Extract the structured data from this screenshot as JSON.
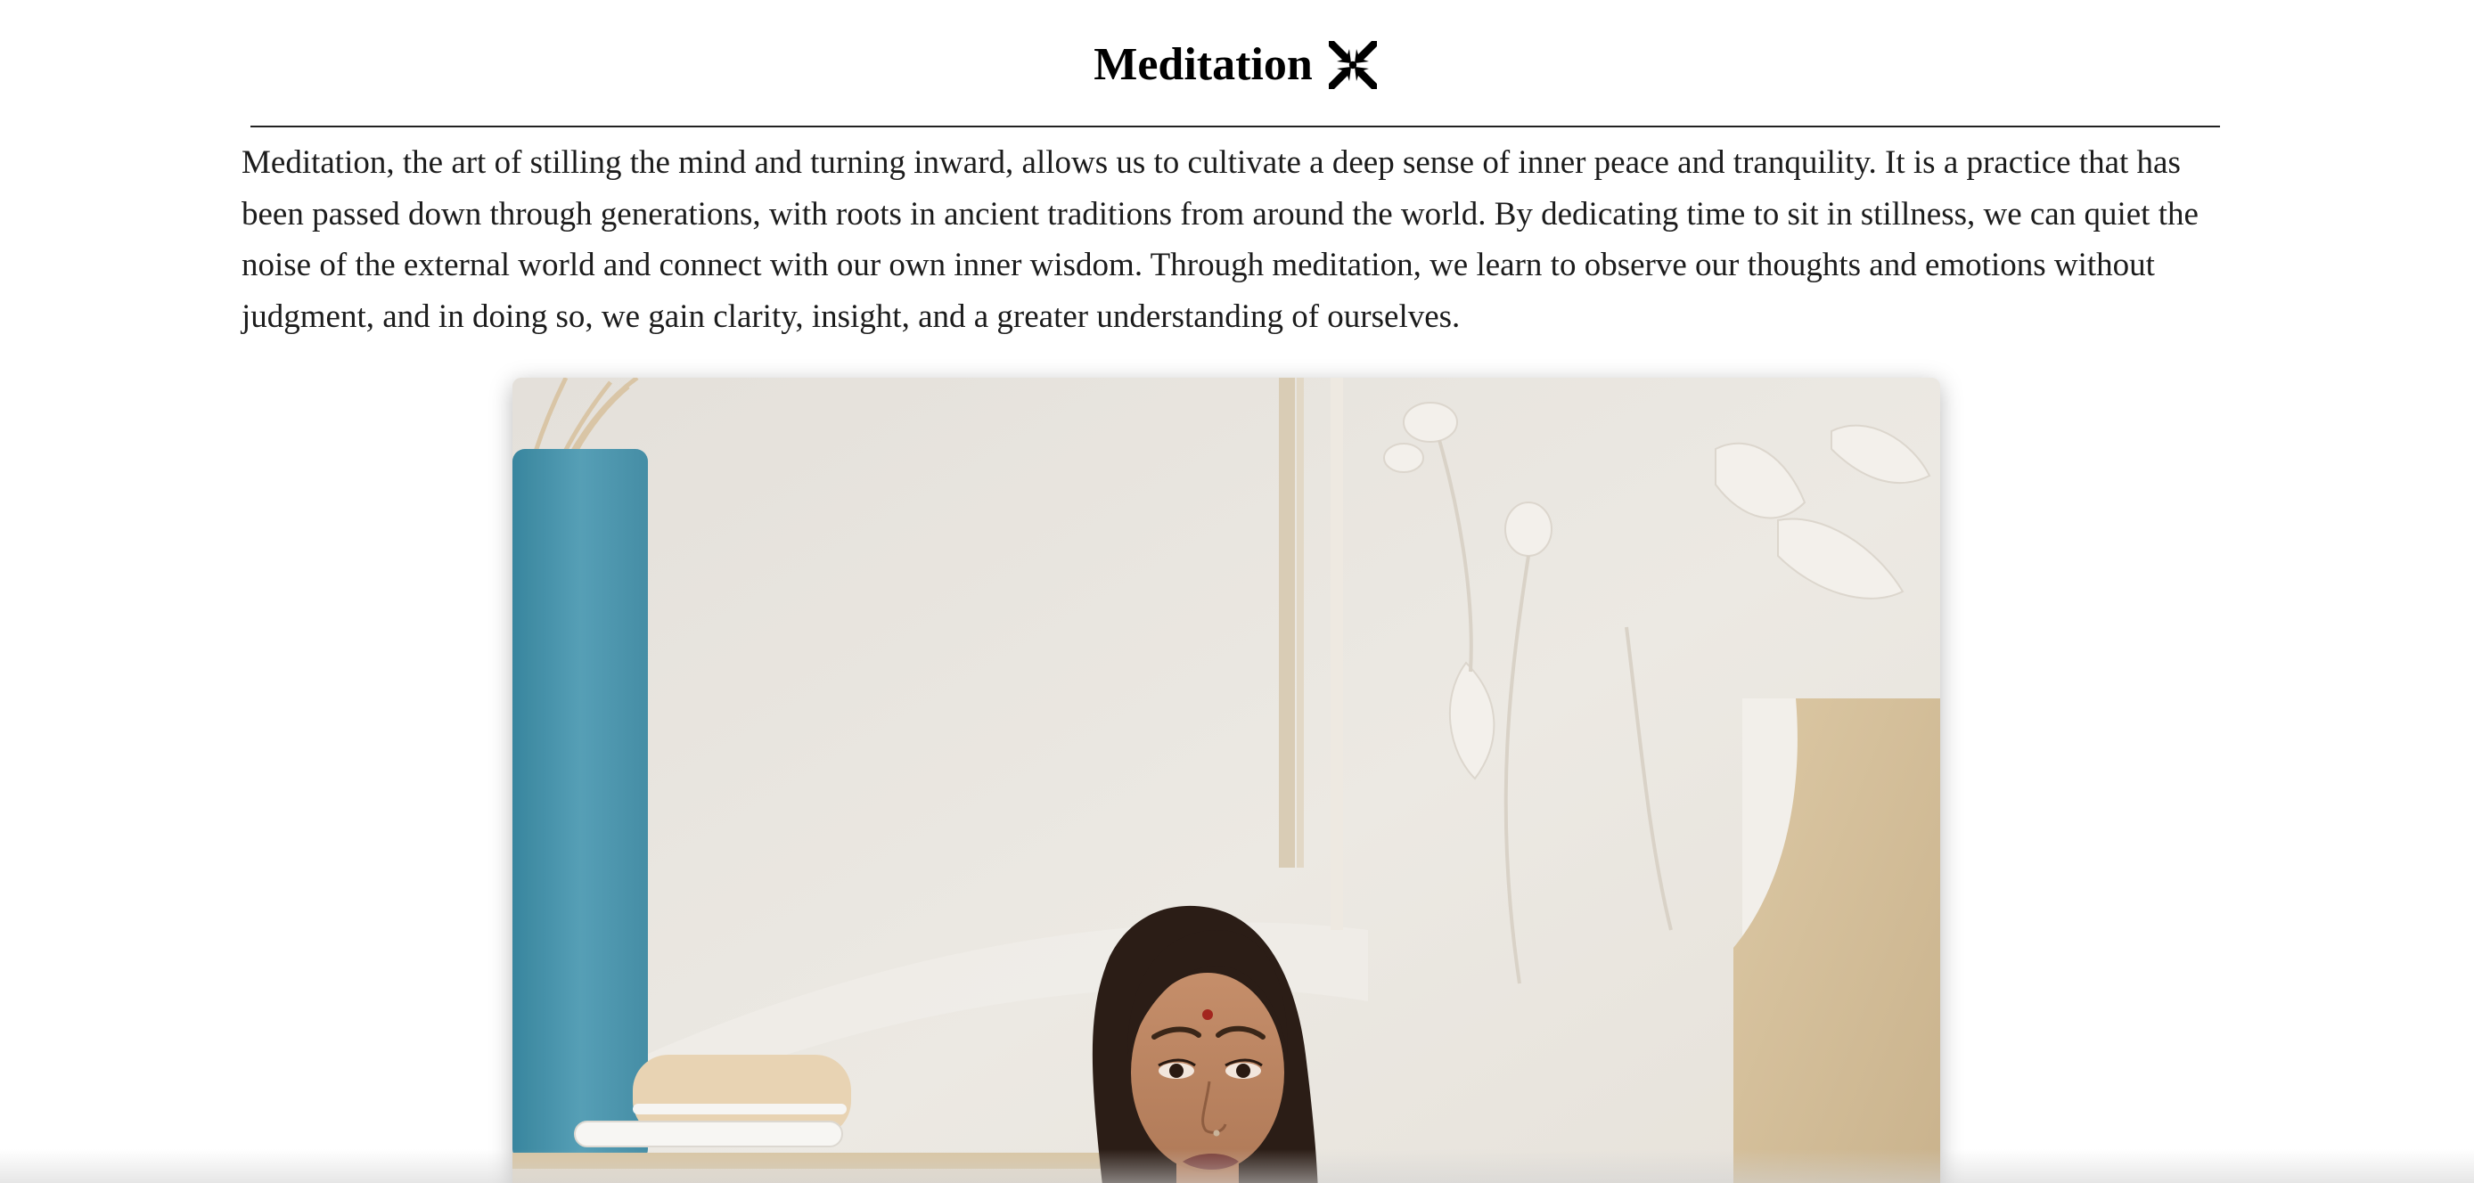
{
  "article": {
    "title": "Meditation",
    "title_icon": "arrows-converging-to-center-icon",
    "intro": "Meditation, the art of stilling the mind and turning inward, allows us to cultivate a deep sense of inner peace and tranquility. It is a practice that has been passed down through generations, with roots in ancient traditions from around the world. By dedicating time to sit in stillness, we can quiet the noise of the external world and connect with our own inner wisdom. Through meditation, we learn to observe our thoughts and emotions without judgment, and in doing so, we gain clarity, insight, and a greater understanding of ourselves."
  },
  "image": {
    "subject": "woman-meditating-photo"
  },
  "colors": {
    "text": "#1c1c1c",
    "rule": "#222222",
    "wall": "#eae6df",
    "teal_panel": "#3f8fa8",
    "beige_panel": "#d6c19c"
  }
}
